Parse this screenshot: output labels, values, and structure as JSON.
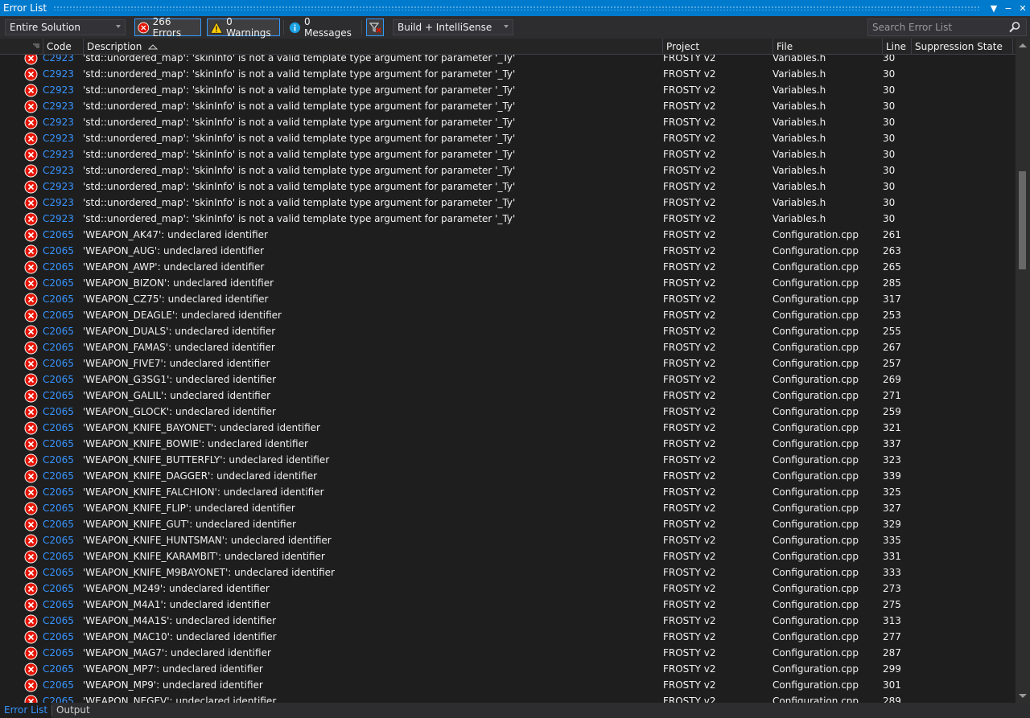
{
  "window": {
    "title": "Error List"
  },
  "toolbar": {
    "scope": "Entire Solution",
    "errors": "266 Errors",
    "warnings": "0 Warnings",
    "messages": "0 Messages",
    "build_filter": "Build + IntelliSense",
    "search_placeholder": "Search Error List"
  },
  "columns": {
    "code": "Code",
    "description": "Description",
    "project": "Project",
    "file": "File",
    "line": "Line",
    "suppression": "Suppression State"
  },
  "colors": {
    "accent": "#007acc",
    "error": "#e51400",
    "link": "#3794ff"
  },
  "rows": [
    {
      "code": "C2923",
      "desc": "'std::unordered_map': 'skinInfo' is not a valid template type argument for parameter '_Ty'",
      "project": "FROSTY v2",
      "file": "Variables.h",
      "line": "30"
    },
    {
      "code": "C2923",
      "desc": "'std::unordered_map': 'skinInfo' is not a valid template type argument for parameter '_Ty'",
      "project": "FROSTY v2",
      "file": "Variables.h",
      "line": "30"
    },
    {
      "code": "C2923",
      "desc": "'std::unordered_map': 'skinInfo' is not a valid template type argument for parameter '_Ty'",
      "project": "FROSTY v2",
      "file": "Variables.h",
      "line": "30"
    },
    {
      "code": "C2923",
      "desc": "'std::unordered_map': 'skinInfo' is not a valid template type argument for parameter '_Ty'",
      "project": "FROSTY v2",
      "file": "Variables.h",
      "line": "30"
    },
    {
      "code": "C2923",
      "desc": "'std::unordered_map': 'skinInfo' is not a valid template type argument for parameter '_Ty'",
      "project": "FROSTY v2",
      "file": "Variables.h",
      "line": "30"
    },
    {
      "code": "C2923",
      "desc": "'std::unordered_map': 'skinInfo' is not a valid template type argument for parameter '_Ty'",
      "project": "FROSTY v2",
      "file": "Variables.h",
      "line": "30"
    },
    {
      "code": "C2923",
      "desc": "'std::unordered_map': 'skinInfo' is not a valid template type argument for parameter '_Ty'",
      "project": "FROSTY v2",
      "file": "Variables.h",
      "line": "30"
    },
    {
      "code": "C2923",
      "desc": "'std::unordered_map': 'skinInfo' is not a valid template type argument for parameter '_Ty'",
      "project": "FROSTY v2",
      "file": "Variables.h",
      "line": "30"
    },
    {
      "code": "C2923",
      "desc": "'std::unordered_map': 'skinInfo' is not a valid template type argument for parameter '_Ty'",
      "project": "FROSTY v2",
      "file": "Variables.h",
      "line": "30"
    },
    {
      "code": "C2923",
      "desc": "'std::unordered_map': 'skinInfo' is not a valid template type argument for parameter '_Ty'",
      "project": "FROSTY v2",
      "file": "Variables.h",
      "line": "30"
    },
    {
      "code": "C2923",
      "desc": "'std::unordered_map': 'skinInfo' is not a valid template type argument for parameter '_Ty'",
      "project": "FROSTY v2",
      "file": "Variables.h",
      "line": "30"
    },
    {
      "code": "C2065",
      "desc": "'WEAPON_AK47': undeclared identifier",
      "project": "FROSTY v2",
      "file": "Configuration.cpp",
      "line": "261"
    },
    {
      "code": "C2065",
      "desc": "'WEAPON_AUG': undeclared identifier",
      "project": "FROSTY v2",
      "file": "Configuration.cpp",
      "line": "263"
    },
    {
      "code": "C2065",
      "desc": "'WEAPON_AWP': undeclared identifier",
      "project": "FROSTY v2",
      "file": "Configuration.cpp",
      "line": "265"
    },
    {
      "code": "C2065",
      "desc": "'WEAPON_BIZON': undeclared identifier",
      "project": "FROSTY v2",
      "file": "Configuration.cpp",
      "line": "285"
    },
    {
      "code": "C2065",
      "desc": "'WEAPON_CZ75': undeclared identifier",
      "project": "FROSTY v2",
      "file": "Configuration.cpp",
      "line": "317"
    },
    {
      "code": "C2065",
      "desc": "'WEAPON_DEAGLE': undeclared identifier",
      "project": "FROSTY v2",
      "file": "Configuration.cpp",
      "line": "253"
    },
    {
      "code": "C2065",
      "desc": "'WEAPON_DUALS': undeclared identifier",
      "project": "FROSTY v2",
      "file": "Configuration.cpp",
      "line": "255"
    },
    {
      "code": "C2065",
      "desc": "'WEAPON_FAMAS': undeclared identifier",
      "project": "FROSTY v2",
      "file": "Configuration.cpp",
      "line": "267"
    },
    {
      "code": "C2065",
      "desc": "'WEAPON_FIVE7': undeclared identifier",
      "project": "FROSTY v2",
      "file": "Configuration.cpp",
      "line": "257"
    },
    {
      "code": "C2065",
      "desc": "'WEAPON_G3SG1': undeclared identifier",
      "project": "FROSTY v2",
      "file": "Configuration.cpp",
      "line": "269"
    },
    {
      "code": "C2065",
      "desc": "'WEAPON_GALIL': undeclared identifier",
      "project": "FROSTY v2",
      "file": "Configuration.cpp",
      "line": "271"
    },
    {
      "code": "C2065",
      "desc": "'WEAPON_GLOCK': undeclared identifier",
      "project": "FROSTY v2",
      "file": "Configuration.cpp",
      "line": "259"
    },
    {
      "code": "C2065",
      "desc": "'WEAPON_KNIFE_BAYONET': undeclared identifier",
      "project": "FROSTY v2",
      "file": "Configuration.cpp",
      "line": "321"
    },
    {
      "code": "C2065",
      "desc": "'WEAPON_KNIFE_BOWIE': undeclared identifier",
      "project": "FROSTY v2",
      "file": "Configuration.cpp",
      "line": "337"
    },
    {
      "code": "C2065",
      "desc": "'WEAPON_KNIFE_BUTTERFLY': undeclared identifier",
      "project": "FROSTY v2",
      "file": "Configuration.cpp",
      "line": "323"
    },
    {
      "code": "C2065",
      "desc": "'WEAPON_KNIFE_DAGGER': undeclared identifier",
      "project": "FROSTY v2",
      "file": "Configuration.cpp",
      "line": "339"
    },
    {
      "code": "C2065",
      "desc": "'WEAPON_KNIFE_FALCHION': undeclared identifier",
      "project": "FROSTY v2",
      "file": "Configuration.cpp",
      "line": "325"
    },
    {
      "code": "C2065",
      "desc": "'WEAPON_KNIFE_FLIP': undeclared identifier",
      "project": "FROSTY v2",
      "file": "Configuration.cpp",
      "line": "327"
    },
    {
      "code": "C2065",
      "desc": "'WEAPON_KNIFE_GUT': undeclared identifier",
      "project": "FROSTY v2",
      "file": "Configuration.cpp",
      "line": "329"
    },
    {
      "code": "C2065",
      "desc": "'WEAPON_KNIFE_HUNTSMAN': undeclared identifier",
      "project": "FROSTY v2",
      "file": "Configuration.cpp",
      "line": "335"
    },
    {
      "code": "C2065",
      "desc": "'WEAPON_KNIFE_KARAMBIT': undeclared identifier",
      "project": "FROSTY v2",
      "file": "Configuration.cpp",
      "line": "331"
    },
    {
      "code": "C2065",
      "desc": "'WEAPON_KNIFE_M9BAYONET': undeclared identifier",
      "project": "FROSTY v2",
      "file": "Configuration.cpp",
      "line": "333"
    },
    {
      "code": "C2065",
      "desc": "'WEAPON_M249': undeclared identifier",
      "project": "FROSTY v2",
      "file": "Configuration.cpp",
      "line": "273"
    },
    {
      "code": "C2065",
      "desc": "'WEAPON_M4A1': undeclared identifier",
      "project": "FROSTY v2",
      "file": "Configuration.cpp",
      "line": "275"
    },
    {
      "code": "C2065",
      "desc": "'WEAPON_M4A1S': undeclared identifier",
      "project": "FROSTY v2",
      "file": "Configuration.cpp",
      "line": "313"
    },
    {
      "code": "C2065",
      "desc": "'WEAPON_MAC10': undeclared identifier",
      "project": "FROSTY v2",
      "file": "Configuration.cpp",
      "line": "277"
    },
    {
      "code": "C2065",
      "desc": "'WEAPON_MAG7': undeclared identifier",
      "project": "FROSTY v2",
      "file": "Configuration.cpp",
      "line": "287"
    },
    {
      "code": "C2065",
      "desc": "'WEAPON_MP7': undeclared identifier",
      "project": "FROSTY v2",
      "file": "Configuration.cpp",
      "line": "299"
    },
    {
      "code": "C2065",
      "desc": "'WEAPON_MP9': undeclared identifier",
      "project": "FROSTY v2",
      "file": "Configuration.cpp",
      "line": "301"
    },
    {
      "code": "C2065",
      "desc": "'WEAPON_NEGEV': undeclared identifier",
      "project": "FROSTY v2",
      "file": "Configuration.cpp",
      "line": "289"
    }
  ],
  "tabs": [
    "Error List",
    "Output"
  ]
}
